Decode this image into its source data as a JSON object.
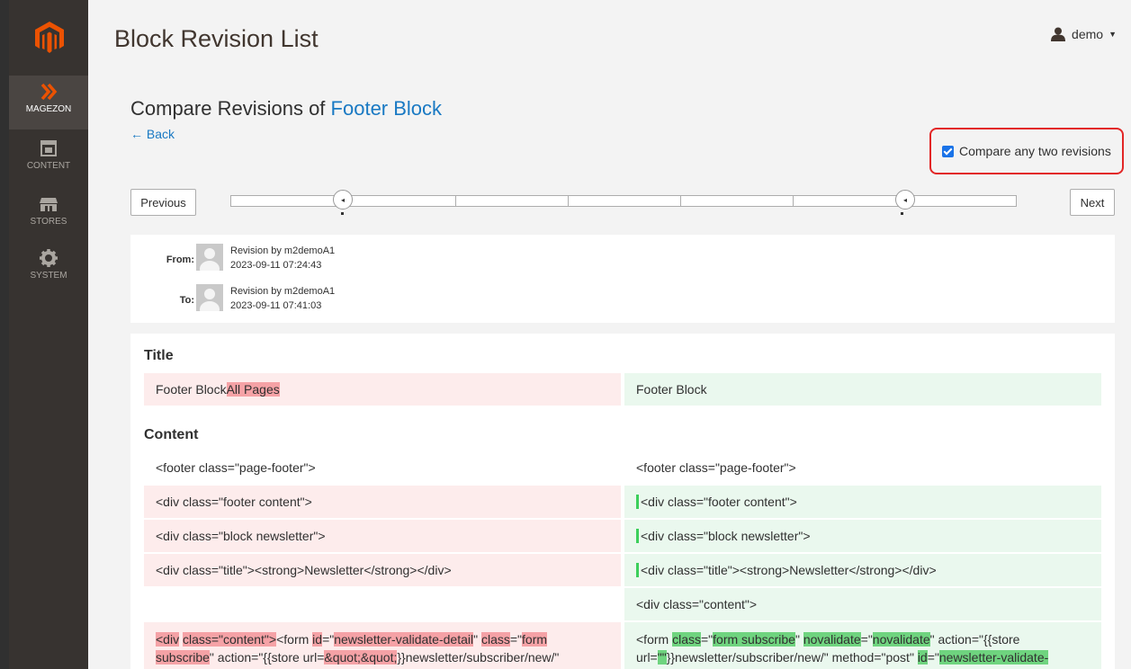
{
  "header": {
    "title": "Block Revision List",
    "user": "demo"
  },
  "sidebar": {
    "items": [
      {
        "label": "MAGEZON",
        "icon": "double-chevron-icon"
      },
      {
        "label": "CONTENT",
        "icon": "layout-icon"
      },
      {
        "label": "STORES",
        "icon": "storefront-icon"
      },
      {
        "label": "SYSTEM",
        "icon": "gear-icon"
      }
    ]
  },
  "compare": {
    "heading": "Compare Revisions of ",
    "block_name": "Footer Block",
    "back": "← Back",
    "any_two_label": "Compare any two revisions",
    "any_two_checked": true
  },
  "timeline": {
    "previous": "Previous",
    "next": "Next"
  },
  "revisions": {
    "from": {
      "label": "From:",
      "author": "Revision by m2demoA1",
      "date": "2023-09-11 07:24:43"
    },
    "to": {
      "label": "To:",
      "author": "Revision by m2demoA1",
      "date": "2023-09-11 07:41:03"
    }
  },
  "diff": {
    "title_section": {
      "heading": "Title",
      "left_plain": "Footer Block",
      "left_removed": " All Pages",
      "right": "Footer Block"
    },
    "content_section": {
      "heading": "Content",
      "row1_left": "<footer class=\"page-footer\">",
      "row1_right": "<footer class=\"page-footer\">",
      "row2_left": "<div class=\"footer content\">",
      "row2_right": "<div class=\"footer content\">",
      "row3_left": "<div class=\"block newsletter\">",
      "row3_right": "<div class=\"block newsletter\">",
      "row4_left": "<div class=\"title\"><strong>Newsletter</strong></div>",
      "row4_right": "<div class=\"title\"><strong>Newsletter</strong></div>",
      "row5_right": "<div class=\"content\">",
      "row6_left": {
        "a": "<div",
        "b": " ",
        "c": "class=\"content\">",
        "d": "<form ",
        "e": "id",
        "f": "=\"",
        "g": "newsletter-validate-detail",
        "h": "\" ",
        "i": "class",
        "j": "=\"",
        "k": "form",
        "l": "subscribe",
        "m": "\" action=\"{{store url=",
        "n": "&quot;&quot;",
        "o": "}}newsletter/subscriber/new/\""
      },
      "row6_right": {
        "a": "<form ",
        "b": "class",
        "c": "=\"",
        "d": "form subscribe",
        "e": "\" ",
        "f": "novalidate",
        "g": "=\"",
        "h": "novalidate",
        "i": "\" action=\"{{store",
        "j": "url=",
        "k": "\"\"",
        "l": "}}newsletter/subscriber/new/\" method=\"post\" ",
        "m": "id",
        "n": "=\"",
        "o": "newsletter-validate-"
      }
    }
  },
  "colors": {
    "accent": "#1979c3",
    "sidebar_bg": "#373330",
    "logo": "#eb5202",
    "removed_bg": "#fdecec",
    "added_bg": "#eaf8ee",
    "removed_hl": "#f5a2a6",
    "added_hl": "#6fd47f"
  }
}
